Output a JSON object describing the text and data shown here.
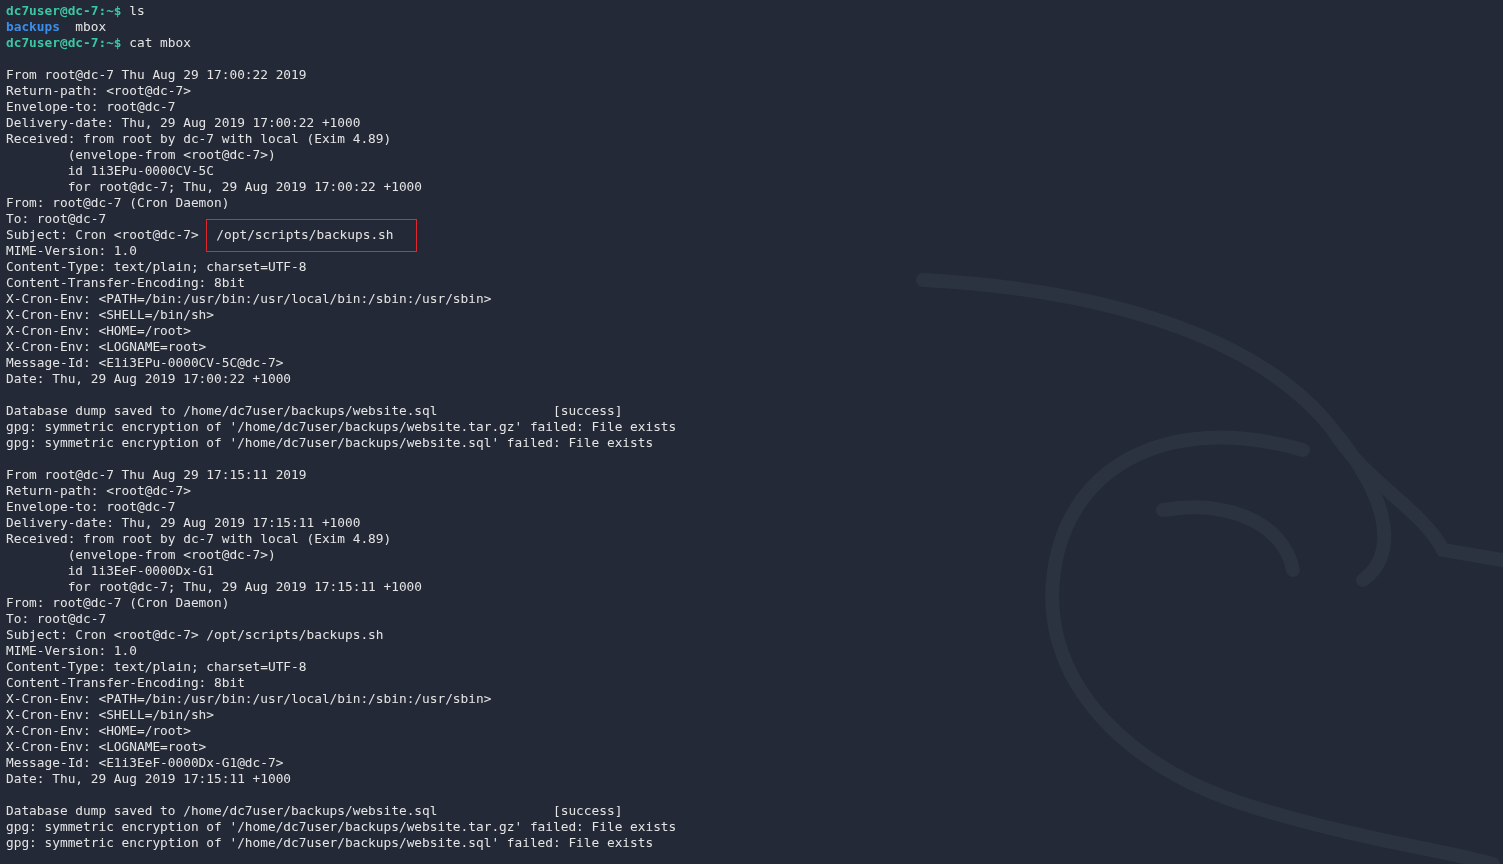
{
  "lines": [
    {
      "kind": "prompt",
      "prompt": "dc7user@dc-7",
      "path": ":~$",
      "command": " ls"
    },
    {
      "kind": "listing",
      "entries": [
        {
          "name": "backups",
          "kind": "dir"
        },
        {
          "name": "mbox",
          "kind": "file"
        }
      ]
    },
    {
      "kind": "prompt",
      "prompt": "dc7user@dc-7",
      "path": ":~$",
      "command": " cat mbox"
    },
    {
      "kind": "blank"
    },
    {
      "kind": "text",
      "text": "From root@dc-7 Thu Aug 29 17:00:22 2019"
    },
    {
      "kind": "text",
      "text": "Return-path: <root@dc-7>"
    },
    {
      "kind": "text",
      "text": "Envelope-to: root@dc-7"
    },
    {
      "kind": "text",
      "text": "Delivery-date: Thu, 29 Aug 2019 17:00:22 +1000"
    },
    {
      "kind": "text",
      "text": "Received: from root by dc-7 with local (Exim 4.89)"
    },
    {
      "kind": "indented",
      "text": "(envelope-from <root@dc-7>)"
    },
    {
      "kind": "indented",
      "text": "id 1i3EPu-0000CV-5C"
    },
    {
      "kind": "indented",
      "text": "for root@dc-7; Thu, 29 Aug 2019 17:00:22 +1000"
    },
    {
      "kind": "text",
      "text": "From: root@dc-7 (Cron Daemon)"
    },
    {
      "kind": "text",
      "text": "To: root@dc-7"
    },
    {
      "kind": "highlight",
      "text": "Subject: Cron <root@dc-7>",
      "marked": "/opt/scripts/backups.sh"
    },
    {
      "kind": "text",
      "text": "MIME-Version: 1.0"
    },
    {
      "kind": "text",
      "text": "Content-Type: text/plain; charset=UTF-8"
    },
    {
      "kind": "text",
      "text": "Content-Transfer-Encoding: 8bit"
    },
    {
      "kind": "text",
      "text": "X-Cron-Env: <PATH=/bin:/usr/bin:/usr/local/bin:/sbin:/usr/sbin>"
    },
    {
      "kind": "text",
      "text": "X-Cron-Env: <SHELL=/bin/sh>"
    },
    {
      "kind": "text",
      "text": "X-Cron-Env: <HOME=/root>"
    },
    {
      "kind": "text",
      "text": "X-Cron-Env: <LOGNAME=root>"
    },
    {
      "kind": "text",
      "text": "Message-Id: <E1i3EPu-0000CV-5C@dc-7>"
    },
    {
      "kind": "text",
      "text": "Date: Thu, 29 Aug 2019 17:00:22 +1000"
    },
    {
      "kind": "blank"
    },
    {
      "kind": "text",
      "text": "Database dump saved to /home/dc7user/backups/website.sql               [success]"
    },
    {
      "kind": "text",
      "text": "gpg: symmetric encryption of '/home/dc7user/backups/website.tar.gz' failed: File exists"
    },
    {
      "kind": "text",
      "text": "gpg: symmetric encryption of '/home/dc7user/backups/website.sql' failed: File exists"
    },
    {
      "kind": "blank"
    },
    {
      "kind": "text",
      "text": "From root@dc-7 Thu Aug 29 17:15:11 2019"
    },
    {
      "kind": "text",
      "text": "Return-path: <root@dc-7>"
    },
    {
      "kind": "text",
      "text": "Envelope-to: root@dc-7"
    },
    {
      "kind": "text",
      "text": "Delivery-date: Thu, 29 Aug 2019 17:15:11 +1000"
    },
    {
      "kind": "text",
      "text": "Received: from root by dc-7 with local (Exim 4.89)"
    },
    {
      "kind": "indented",
      "text": "(envelope-from <root@dc-7>)"
    },
    {
      "kind": "indented",
      "text": "id 1i3EeF-0000Dx-G1"
    },
    {
      "kind": "indented",
      "text": "for root@dc-7; Thu, 29 Aug 2019 17:15:11 +1000"
    },
    {
      "kind": "text",
      "text": "From: root@dc-7 (Cron Daemon)"
    },
    {
      "kind": "text",
      "text": "To: root@dc-7"
    },
    {
      "kind": "text",
      "text": "Subject: Cron <root@dc-7> /opt/scripts/backups.sh"
    },
    {
      "kind": "text",
      "text": "MIME-Version: 1.0"
    },
    {
      "kind": "text",
      "text": "Content-Type: text/plain; charset=UTF-8"
    },
    {
      "kind": "text",
      "text": "Content-Transfer-Encoding: 8bit"
    },
    {
      "kind": "text",
      "text": "X-Cron-Env: <PATH=/bin:/usr/bin:/usr/local/bin:/sbin:/usr/sbin>"
    },
    {
      "kind": "text",
      "text": "X-Cron-Env: <SHELL=/bin/sh>"
    },
    {
      "kind": "text",
      "text": "X-Cron-Env: <HOME=/root>"
    },
    {
      "kind": "text",
      "text": "X-Cron-Env: <LOGNAME=root>"
    },
    {
      "kind": "text",
      "text": "Message-Id: <E1i3EeF-0000Dx-G1@dc-7>"
    },
    {
      "kind": "text",
      "text": "Date: Thu, 29 Aug 2019 17:15:11 +1000"
    },
    {
      "kind": "blank"
    },
    {
      "kind": "text",
      "text": "Database dump saved to /home/dc7user/backups/website.sql               [success]"
    },
    {
      "kind": "text",
      "text": "gpg: symmetric encryption of '/home/dc7user/backups/website.tar.gz' failed: File exists"
    },
    {
      "kind": "text",
      "text": "gpg: symmetric encryption of '/home/dc7user/backups/website.sql' failed: File exists"
    }
  ]
}
